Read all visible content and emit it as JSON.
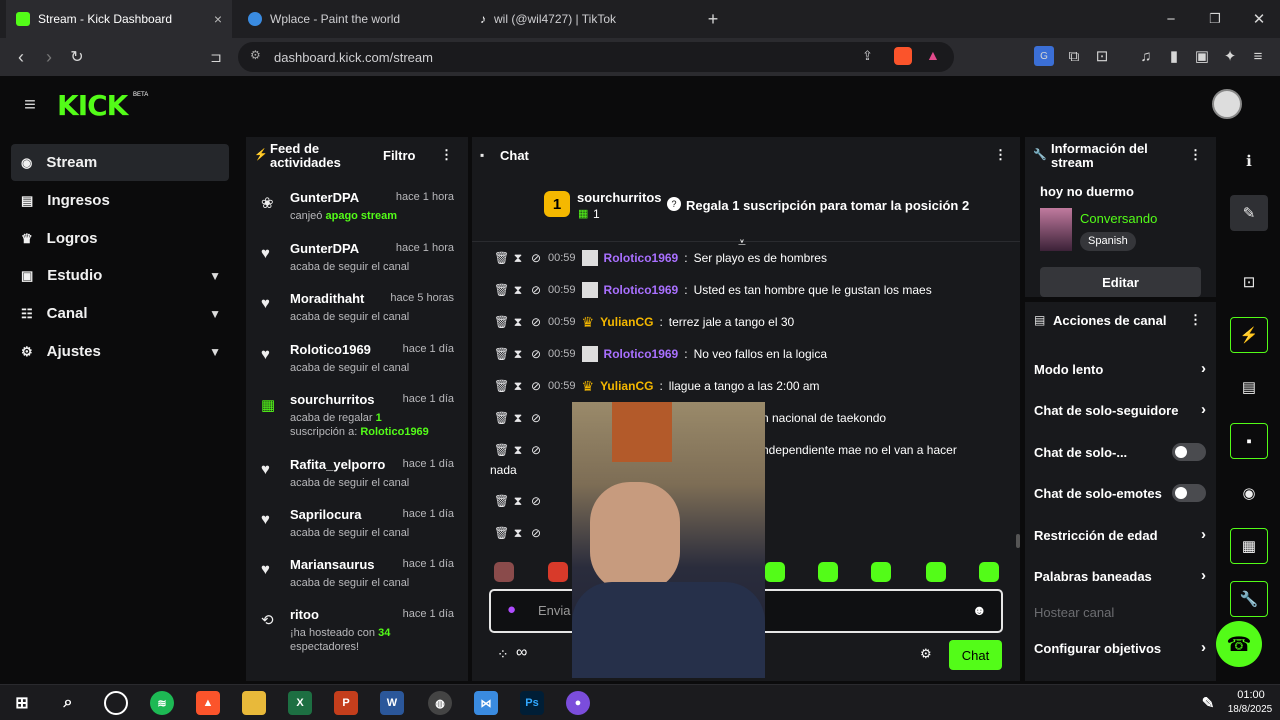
{
  "browser": {
    "tabs": [
      {
        "title": "Stream - Kick Dashboard",
        "close": "×"
      },
      {
        "title": "Wplace - Paint the world"
      },
      {
        "title": "wil (@wil4727) | TikTok"
      }
    ],
    "new_tab": "+",
    "url": "dashboard.kick.com/stream",
    "window_controls": {
      "minimize": "−",
      "restore": "❐",
      "close": "✕"
    }
  },
  "header": {
    "logo": "KICK",
    "badge": "BETA"
  },
  "sidebar": {
    "items": [
      {
        "label": "Stream",
        "icon": "stream-icon"
      },
      {
        "label": "Ingresos",
        "icon": "income-icon"
      },
      {
        "label": "Logros",
        "icon": "trophy-icon"
      },
      {
        "label": "Estudio",
        "icon": "studio-icon"
      },
      {
        "label": "Canal",
        "icon": "channel-icon"
      },
      {
        "label": "Ajustes",
        "icon": "gear-icon"
      }
    ]
  },
  "feed": {
    "title": "Feed de actividades",
    "filter": "Filtro",
    "items": [
      {
        "name": "GunterDPA",
        "time": "hace 1 hora",
        "desc": "canjeó",
        "highlight": "apago stream"
      },
      {
        "name": "GunterDPA",
        "time": "hace 1 hora",
        "desc": "acaba de seguir el canal"
      },
      {
        "name": "Moradithaht",
        "time": "hace 5 horas",
        "desc": "acaba de seguir el canal"
      },
      {
        "name": "Rolotico1969",
        "time": "hace 1 día",
        "desc": "acaba de seguir el canal"
      },
      {
        "name": "sourchurritos",
        "time": "hace 1 día",
        "desc": "acaba de regalar",
        "highlight": "1",
        "desc2": "suscripción a:",
        "highlight2": "Rolotico1969"
      },
      {
        "name": "Rafita_yelporro",
        "time": "hace 1 día",
        "desc": "acaba de seguir el canal"
      },
      {
        "name": "Saprilocura",
        "time": "hace 1 día",
        "desc": "acaba de seguir el canal"
      },
      {
        "name": "Mariansaurus",
        "time": "hace 1 día",
        "desc": "acaba de seguir el canal"
      },
      {
        "name": "ritoo",
        "time": "hace 1 día",
        "desc": "¡ha hosteado con",
        "highlight": "34",
        "desc2": "espectadores!"
      }
    ]
  },
  "chat": {
    "title": "Chat",
    "leader": {
      "rank": "1",
      "name": "sourchurritos",
      "count": "1"
    },
    "cta": "Regala 1 suscripción para tomar la posición 2",
    "messages": [
      {
        "time": "00:59",
        "user": "Rolotico1969",
        "color": "#a970ff",
        "text": "Ser playo es de hombres"
      },
      {
        "time": "00:59",
        "user": "Rolotico1969",
        "color": "#a970ff",
        "text": "Usted es tan hombre que le gustan los maes"
      },
      {
        "time": "00:59",
        "user": "YulianCG",
        "color": "#f5b800",
        "text": "terrez jale a tango el 30"
      },
      {
        "time": "00:59",
        "user": "Rolotico1969",
        "color": "#a970ff",
        "text": "No veo fallos en la logica"
      },
      {
        "time": "00:59",
        "user": "YulianCG",
        "color": "#f5b800",
        "text": "llague a tango a las 2:00 am"
      }
    ],
    "partial_1": "n nacional de taekondo",
    "partial_2": "ndependiente mae no el van a hacer",
    "partial_2b": "nada",
    "input_placeholder": "Envia",
    "send": "Chat",
    "infinity": "∞"
  },
  "stream_info": {
    "title": "Información del stream",
    "stream_title": "hoy no duermo",
    "category": "Conversando",
    "language": "Spanish",
    "edit": "Editar"
  },
  "channel_actions": {
    "title": "Acciones de canal",
    "items": [
      {
        "label": "Modo lento",
        "kind": "arrow"
      },
      {
        "label": "Chat de solo-seguidore",
        "kind": "arrow"
      },
      {
        "label": "Chat de solo-...",
        "kind": "toggle"
      },
      {
        "label": "Chat de solo-emotes",
        "kind": "toggle"
      },
      {
        "label": "Restricción de edad",
        "kind": "arrow"
      },
      {
        "label": "Palabras baneadas",
        "kind": "arrow"
      },
      {
        "label": "Hostear canal",
        "kind": "disabled"
      },
      {
        "label": "Configurar objetivos",
        "kind": "arrow"
      }
    ]
  },
  "taskbar": {
    "time": "01:00",
    "date": "18/8/2025"
  },
  "colors": {
    "accent": "#53fc18",
    "panel": "#18191c",
    "bg": "#0b0b0c"
  }
}
